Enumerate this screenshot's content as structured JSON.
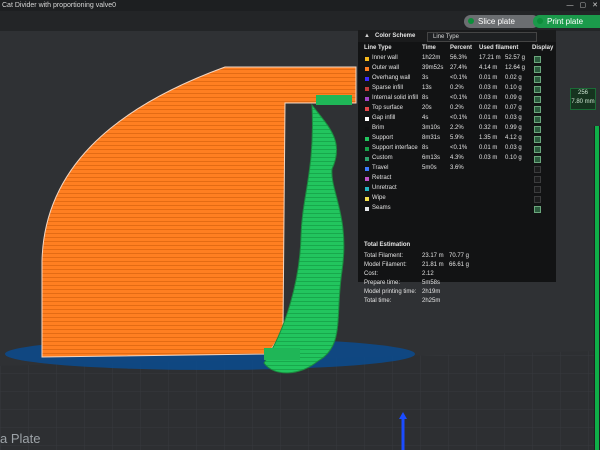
{
  "window": {
    "title": "Cat Divider with proportioning valve0"
  },
  "toolbar": {
    "slice_label": "Slice plate",
    "print_label": "Print plate"
  },
  "layer_badge": {
    "top": "256",
    "bottom": "7.80 mm"
  },
  "panel": {
    "color_scheme_label": "Color Scheme",
    "line_type_value": "Line Type",
    "columns": {
      "line_type": "Line Type",
      "time": "Time",
      "percent": "Percent",
      "used_filament": "Used filament",
      "display": "Display"
    },
    "rows": [
      {
        "name": "Inner wall",
        "color": "#f6b91c",
        "time": "1h22m",
        "percent": "56.3%",
        "used_m": "17.21 m",
        "used_g": "52.57 g",
        "display": true
      },
      {
        "name": "Outer wall",
        "color": "#ff7f21",
        "time": "39m52s",
        "percent": "27.4%",
        "used_m": "4.14 m",
        "used_g": "12.64 g",
        "display": true
      },
      {
        "name": "Overhang wall",
        "color": "#3d2bff",
        "time": "3s",
        "percent": "<0.1%",
        "used_m": "0.01 m",
        "used_g": "0.02 g",
        "display": true
      },
      {
        "name": "Sparse infill",
        "color": "#c43c3c",
        "time": "13s",
        "percent": "0.2%",
        "used_m": "0.03 m",
        "used_g": "0.10 g",
        "display": true
      },
      {
        "name": "Internal solid infill",
        "color": "#a245c9",
        "time": "8s",
        "percent": "<0.1%",
        "used_m": "0.03 m",
        "used_g": "0.09 g",
        "display": true
      },
      {
        "name": "Top surface",
        "color": "#e5474b",
        "time": "20s",
        "percent": "0.2%",
        "used_m": "0.02 m",
        "used_g": "0.07 g",
        "display": true
      },
      {
        "name": "Gap infill",
        "color": "#ffffff",
        "time": "4s",
        "percent": "<0.1%",
        "used_m": "0.01 m",
        "used_g": "0.03 g",
        "display": true
      },
      {
        "name": "Brim",
        "color": "#0f1011",
        "time": "3m10s",
        "percent": "2.2%",
        "used_m": "0.32 m",
        "used_g": "0.99 g",
        "display": true
      },
      {
        "name": "Support",
        "color": "#22c55e",
        "time": "8m31s",
        "percent": "5.9%",
        "used_m": "1.35 m",
        "used_g": "4.12 g",
        "display": true
      },
      {
        "name": "Support interface",
        "color": "#16a34a",
        "time": "8s",
        "percent": "<0.1%",
        "used_m": "0.01 m",
        "used_g": "0.03 g",
        "display": true
      },
      {
        "name": "Custom",
        "color": "#2ea36d",
        "time": "6m13s",
        "percent": "4.3%",
        "used_m": "0.03 m",
        "used_g": "0.10 g",
        "display": true
      },
      {
        "name": "Travel",
        "color": "#3d7bff",
        "time": "5m0s",
        "percent": "3.6%",
        "used_m": "",
        "used_g": "",
        "display": false
      },
      {
        "name": "Retract",
        "color": "#c054c9",
        "time": "",
        "percent": "",
        "used_m": "",
        "used_g": "",
        "display": false
      },
      {
        "name": "Unretract",
        "color": "#25b7c4",
        "time": "",
        "percent": "",
        "used_m": "",
        "used_g": "",
        "display": false
      },
      {
        "name": "Wipe",
        "color": "#f4e04f",
        "time": "",
        "percent": "",
        "used_m": "",
        "used_g": "",
        "display": false
      },
      {
        "name": "Seams",
        "color": "#e5e7eb",
        "time": "",
        "percent": "",
        "used_m": "",
        "used_g": "",
        "display": true
      }
    ],
    "total_title": "Total Estimation",
    "totals": [
      {
        "label": "Total Filament:",
        "v1": "23.17 m",
        "v2": "70.77 g"
      },
      {
        "label": "Model Filament:",
        "v1": "21.81 m",
        "v2": "66.61 g"
      },
      {
        "label": "Cost:",
        "v1": "2.12",
        "v2": ""
      },
      {
        "label": "Prepare time:",
        "v1": "5m58s",
        "v2": ""
      },
      {
        "label": "Model printing time:",
        "v1": "2h19m",
        "v2": ""
      },
      {
        "label": "Total time:",
        "v1": "2h25m",
        "v2": ""
      }
    ]
  },
  "bed_label": "a Plate",
  "colors": {
    "model_orange": "#ff7f21",
    "support_green": "#22c55e",
    "brim_blue": "#0b4b8f",
    "accent_green": "#1b9a4b"
  }
}
